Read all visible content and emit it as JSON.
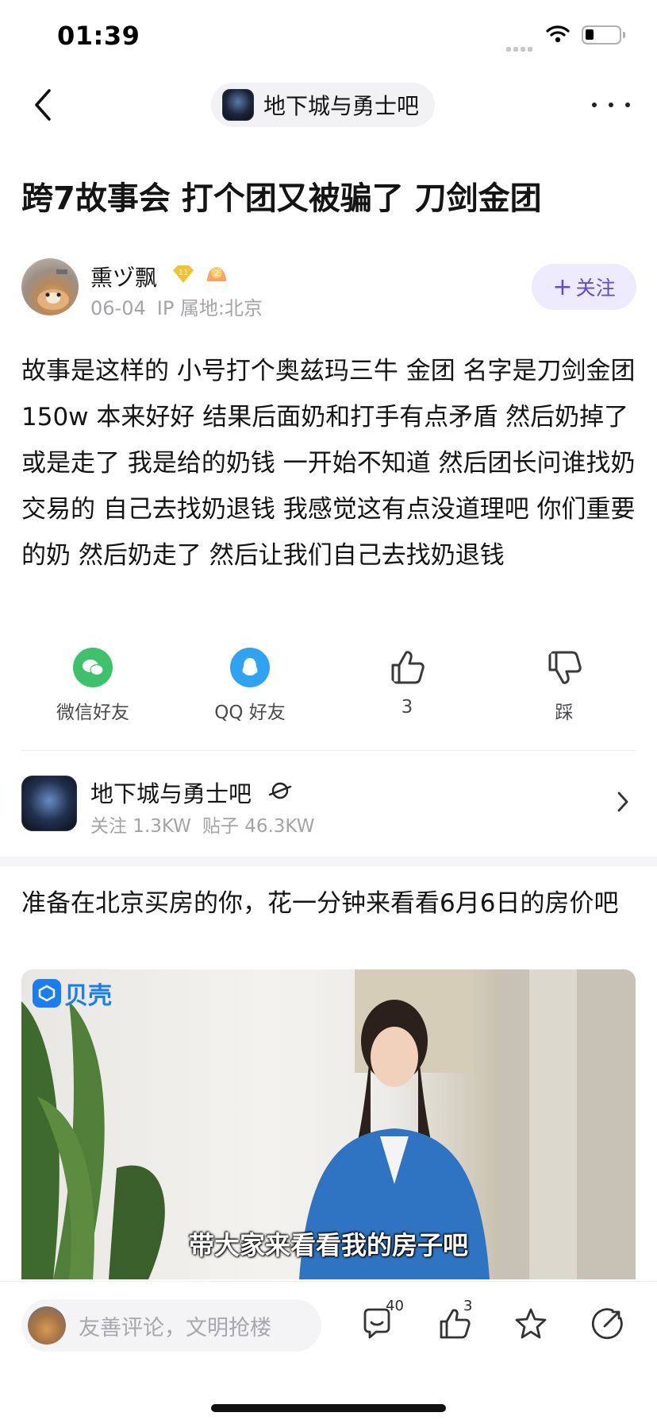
{
  "status_bar": {
    "time": "01:39"
  },
  "nav": {
    "forum_name": "地下城与勇士吧"
  },
  "post": {
    "title": "跨7故事会 打个团又被骗了 刀剑金团",
    "author": {
      "name": "熏ヅ飘",
      "level": "11",
      "medal": "2",
      "date": "06-04",
      "ip": "IP 属地:北京",
      "follow_label": "关注"
    },
    "body": "故事是这样的 小号打个奥兹玛三牛 金团 名字是刀剑金团 150w 本来好好 结果后面奶和打手有点矛盾 然后奶掉了或是走了 我是给的奶钱 一开始不知道 然后团长问谁找奶交易的 自己去找奶退钱 我感觉这有点没道理吧 你们重要的奶 然后奶走了 然后让我们自己去找奶退钱"
  },
  "share": {
    "wechat": "微信好友",
    "qq": "QQ 好友",
    "like_count": "3",
    "dislike": "踩"
  },
  "forum_card": {
    "name": "地下城与勇士吧",
    "follow_stat": "关注 1.3KW",
    "post_stat": "贴子 46.3KW"
  },
  "ad": {
    "title": "准备在北京买房的你，花一分钟来看看6月6日的房价吧",
    "brand": "贝壳",
    "caption": "带大家来看看我的房子吧"
  },
  "bottom_bar": {
    "comment_placeholder": "友善评论，文明抢楼",
    "comment_count": "40",
    "like_count": "3"
  },
  "colors": {
    "accent": "#614bd6",
    "wechat": "#3ec16b",
    "qq": "#2fa3f2",
    "brand": "#1a7ef0"
  }
}
